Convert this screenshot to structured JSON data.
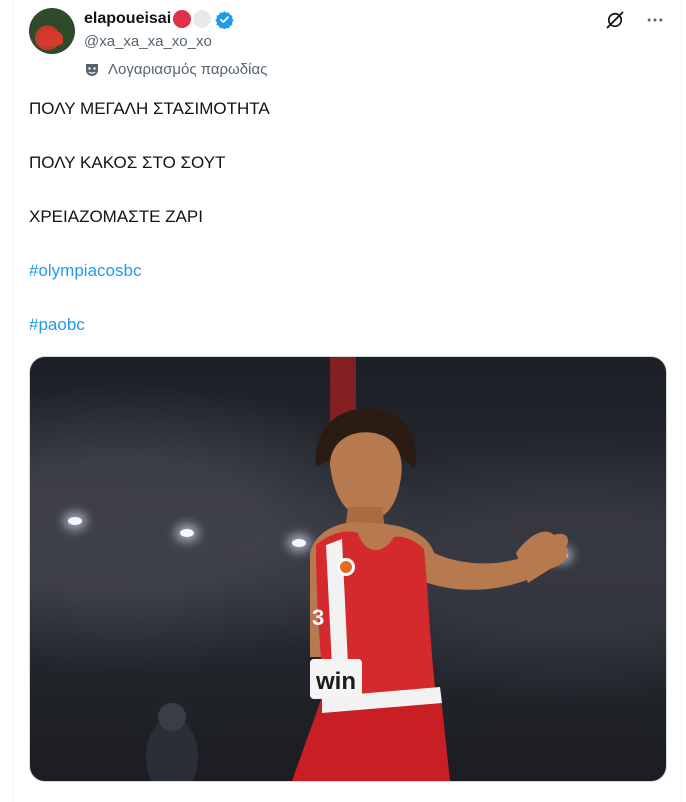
{
  "post": {
    "author": {
      "display_name": "elapoueisai",
      "handle": "@xa_xa_xa_xo_xo",
      "label": "Λογαριασμός παρωδίας",
      "avatar_icon": "avatar-photo"
    },
    "actions": {
      "grok_icon": "grok-icon",
      "more_icon": "more-icon"
    },
    "lines": [
      "ΠΟΛΥ ΜΕΓΑΛΗ ΣΤΑΣΙΜΟΤΗΤΑ",
      "ΠΟΛΥ ΚΑΚΟΣ ΣΤΟ ΣΟΥΤ",
      "ΧΡΕΙΑΖΟΜΑΣΤΕ ΖΑΡΙ"
    ],
    "hashtags": [
      "#olympiacosbc",
      "#paobc"
    ],
    "media": {
      "jersey_number": "3",
      "jersey_text": "win"
    }
  },
  "colors": {
    "accent": "#1d9bf0",
    "text": "#0f1419",
    "muted": "#536471",
    "jersey_red": "#d42a2e"
  }
}
